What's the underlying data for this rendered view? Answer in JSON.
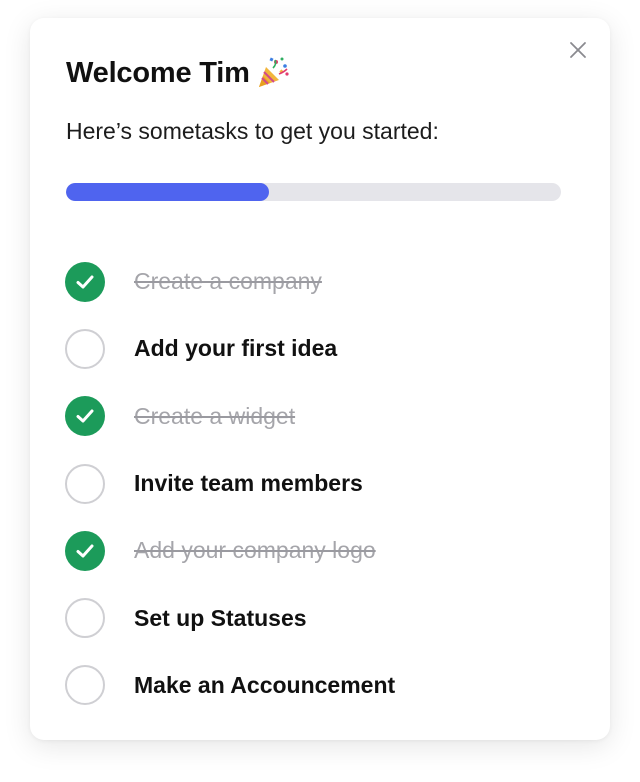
{
  "header": {
    "title": "Welcome Tim",
    "emoji_icon": "party-popper-icon",
    "close_icon": "close-icon"
  },
  "subtitle": "Here’s sometasks to get you started:",
  "progress": {
    "percent": 41,
    "fill_color": "#4f64ef",
    "track_color": "#e5e5ea"
  },
  "tasks": [
    {
      "label": "Create a company",
      "done": true
    },
    {
      "label": "Add your first idea",
      "done": false
    },
    {
      "label": "Create a widget",
      "done": true
    },
    {
      "label": "Invite team members",
      "done": false
    },
    {
      "label": "Add your company logo",
      "done": true
    },
    {
      "label": "Set up Statuses",
      "done": false
    },
    {
      "label": "Make an Accouncement",
      "done": false
    }
  ],
  "colors": {
    "done_check": "#1c9b5a",
    "todo_border": "#cfcfd3"
  }
}
